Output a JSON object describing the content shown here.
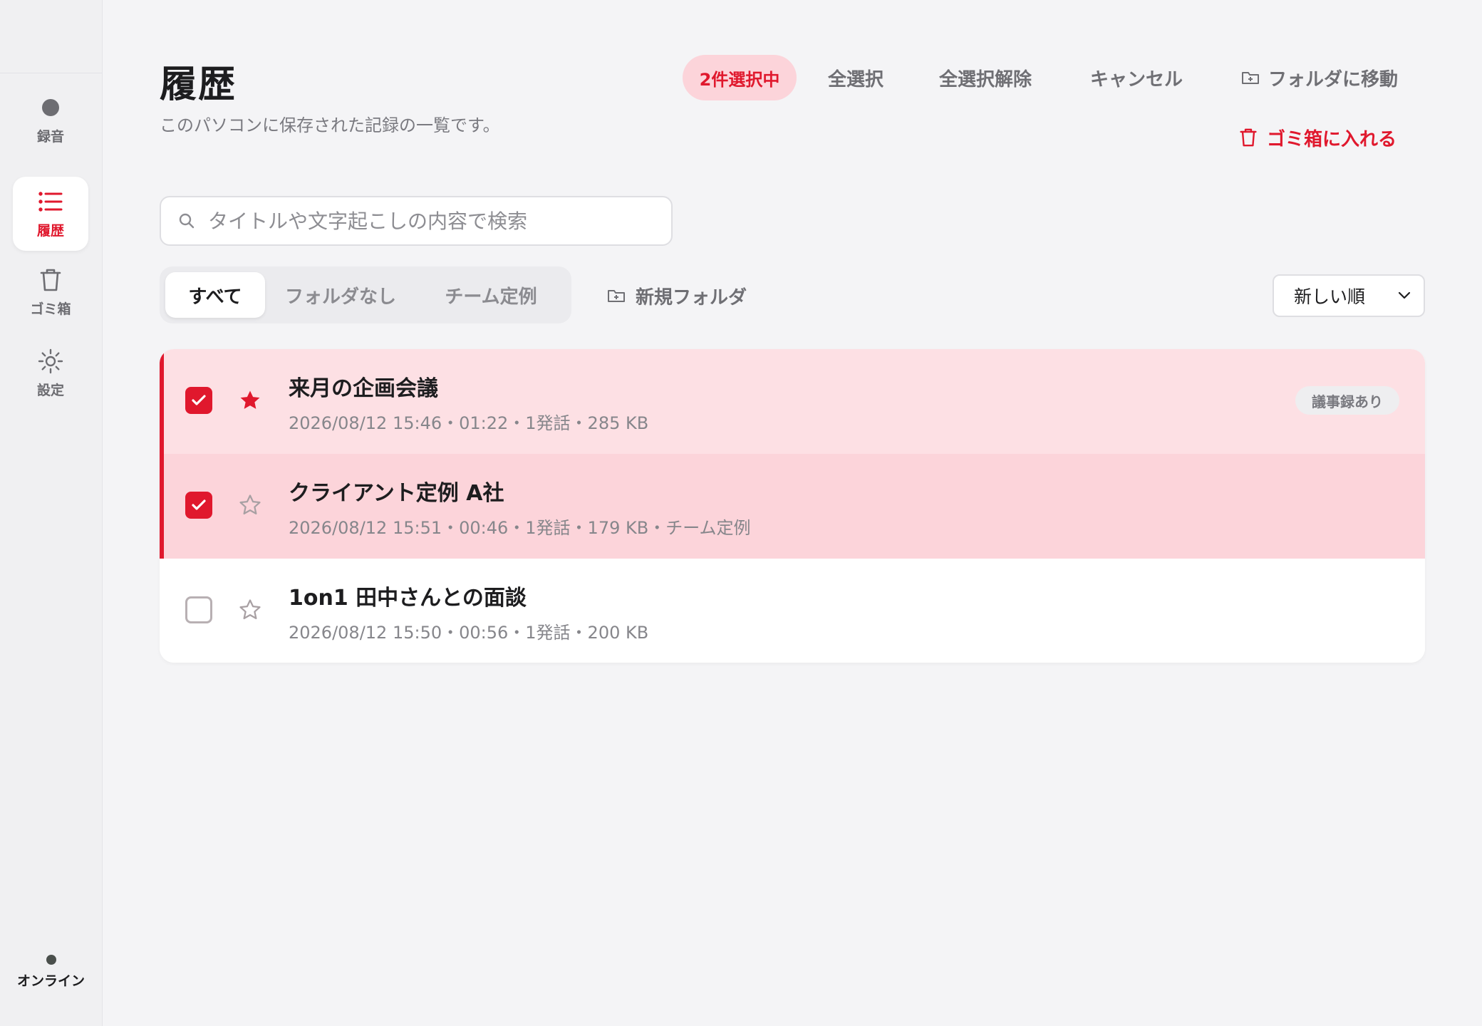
{
  "sidebar": {
    "items": [
      {
        "label": "録音",
        "icon": "record-dot-icon"
      },
      {
        "label": "履歴",
        "icon": "list-icon"
      },
      {
        "label": "ゴミ箱",
        "icon": "trash-icon"
      },
      {
        "label": "設定",
        "icon": "sun-gear-icon"
      }
    ],
    "active_index": 1,
    "status_label": "オンライン"
  },
  "header": {
    "title": "履歴",
    "description": "このパソコンに保存された記録の一覧です。"
  },
  "toolbar": {
    "selection_badge": "2件選択中",
    "select_all": "全選択",
    "deselect_all": "全選択解除",
    "cancel": "キャンセル",
    "move_to_folder": "フォルダに移動",
    "move_to_trash": "ゴミ箱に入れる"
  },
  "search": {
    "placeholder": "タイトルや文字起こしの内容で検索",
    "value": ""
  },
  "filters": {
    "tabs": [
      "すべて",
      "フォルダなし",
      "チーム定例"
    ],
    "active_index": 0,
    "new_folder": "新規フォルダ"
  },
  "sort": {
    "selected": "新しい順"
  },
  "records": [
    {
      "title": "来月の企画会議",
      "meta": "2026/08/12 15:46・01:22・1発話・285 KB",
      "selected": true,
      "starred": true,
      "badge": "議事録あり"
    },
    {
      "title": "クライアント定例 A社",
      "meta": "2026/08/12 15:51・00:46・1発話・179 KB・チーム定例",
      "selected": true,
      "starred": false,
      "badge": ""
    },
    {
      "title": "1on1 田中さんとの面談",
      "meta": "2026/08/12 15:50・00:56・1発話・200 KB",
      "selected": false,
      "starred": false,
      "badge": ""
    }
  ],
  "colors": {
    "accent": "#e0182d",
    "selected_row_1": "#fde0e4",
    "selected_row_2": "#fcd4da",
    "badge_bg": "#fcd4da",
    "background": "#f4f4f6"
  }
}
